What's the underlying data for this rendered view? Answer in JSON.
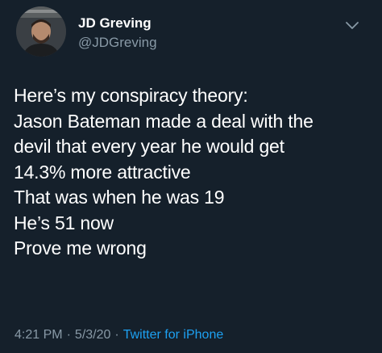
{
  "tweet": {
    "author": {
      "display_name": "JD Greving",
      "handle": "@JDGreving",
      "avatar_icon": "profile-photo"
    },
    "menu_icon": "chevron-down-icon",
    "text_lines": [
      "Here’s my conspiracy theory:",
      "Jason Bateman made a deal with the",
      "devil that every year he would get",
      "14.3% more attractive",
      "That was when he was 19",
      "He’s 51 now",
      "Prove me wrong"
    ],
    "time": "4:21 PM",
    "date": "5/3/20",
    "separator": "·",
    "source": "Twitter for iPhone"
  },
  "colors": {
    "background": "#15202b",
    "text": "#ffffff",
    "secondary_text": "#8899a6",
    "link": "#1da1f2"
  }
}
